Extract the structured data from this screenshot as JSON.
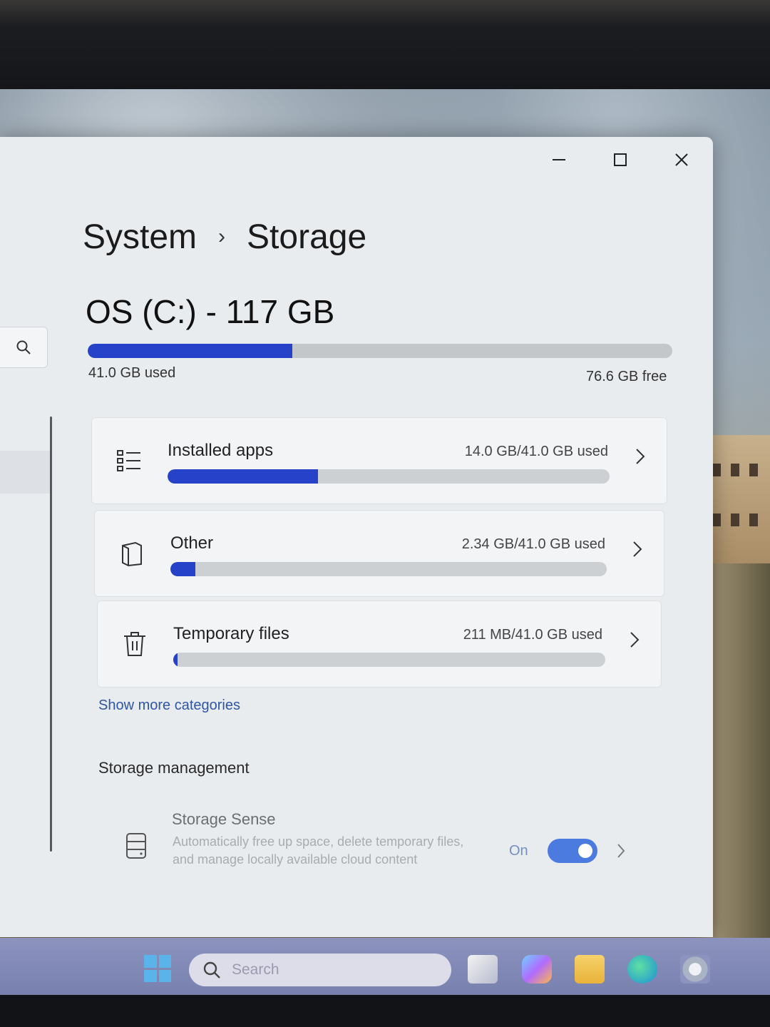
{
  "breadcrumb": {
    "parent": "System",
    "separator": "›",
    "current": "Storage"
  },
  "drive": {
    "title": "OS (C:) - 117 GB",
    "used_label": "41.0 GB used",
    "free_label": "76.6 GB free",
    "used_fraction": 0.35
  },
  "categories": [
    {
      "name": "Installed apps",
      "usage": "14.0 GB/41.0 GB used",
      "fraction": 0.34,
      "icon": "apps-list-icon"
    },
    {
      "name": "Other",
      "usage": "2.34 GB/41.0 GB used",
      "fraction": 0.057,
      "icon": "other-file-icon"
    },
    {
      "name": "Temporary files",
      "usage": "211 MB/41.0 GB used",
      "fraction": 0.005,
      "icon": "trash-icon"
    }
  ],
  "show_more": "Show more categories",
  "management": {
    "heading": "Storage management",
    "storage_sense": {
      "title": "Storage Sense",
      "description": "Automatically free up space, delete temporary files, and manage locally available cloud content",
      "state": "On",
      "enabled": true
    }
  },
  "taskbar": {
    "search_placeholder": "Search"
  },
  "colors": {
    "accent": "#2542c8",
    "toggle": "#4c7be0",
    "link": "#2f56a6"
  }
}
